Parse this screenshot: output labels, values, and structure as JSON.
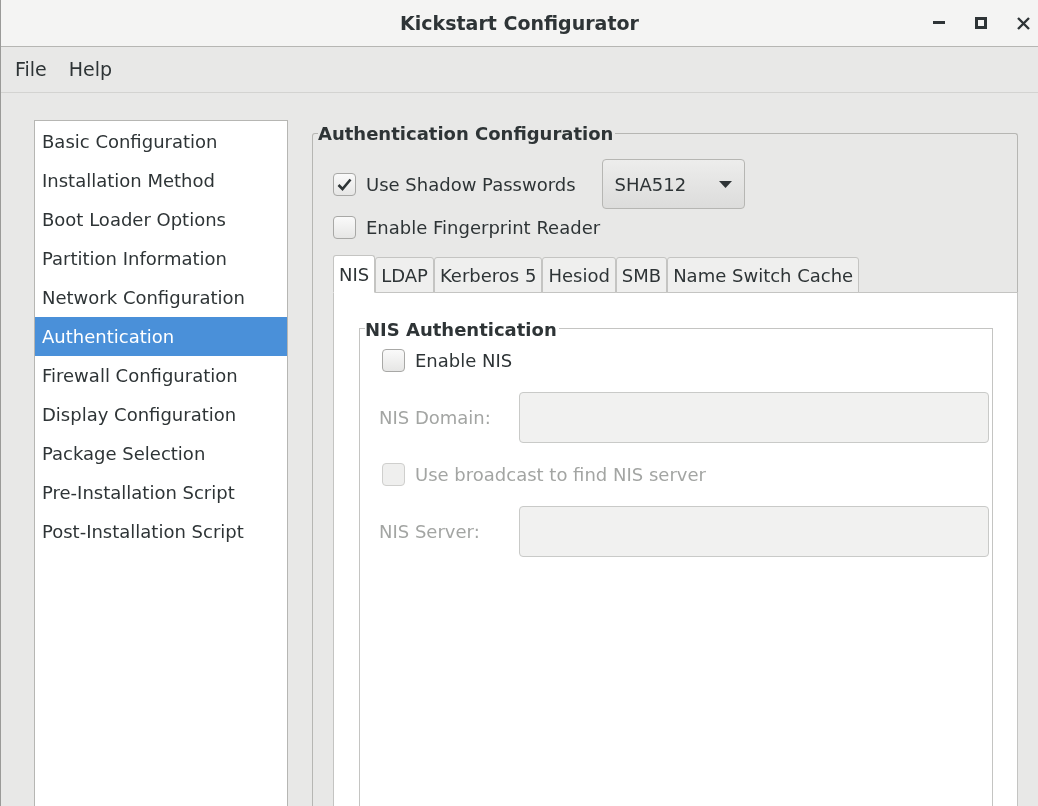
{
  "window": {
    "title": "Kickstart Configurator"
  },
  "menu": [
    "File",
    "Help"
  ],
  "sidebar": {
    "items": [
      {
        "label": "Basic Configuration",
        "selected": false
      },
      {
        "label": "Installation Method",
        "selected": false
      },
      {
        "label": "Boot Loader Options",
        "selected": false
      },
      {
        "label": "Partition Information",
        "selected": false
      },
      {
        "label": "Network Configuration",
        "selected": false
      },
      {
        "label": "Authentication",
        "selected": true
      },
      {
        "label": "Firewall Configuration",
        "selected": false
      },
      {
        "label": "Display Configuration",
        "selected": false
      },
      {
        "label": "Package Selection",
        "selected": false
      },
      {
        "label": "Pre-Installation Script",
        "selected": false
      },
      {
        "label": "Post-Installation Script",
        "selected": false
      }
    ]
  },
  "auth": {
    "title": "Authentication Configuration",
    "shadow": {
      "label": "Use Shadow Passwords",
      "checked": true,
      "algorithm": "SHA512"
    },
    "fingerprint": {
      "label": "Enable Fingerprint Reader",
      "checked": false
    },
    "tabs": [
      {
        "label": "NIS",
        "selected": true
      },
      {
        "label": "LDAP",
        "selected": false
      },
      {
        "label": "Kerberos 5",
        "selected": false
      },
      {
        "label": "Hesiod",
        "selected": false
      },
      {
        "label": "SMB",
        "selected": false
      },
      {
        "label": "Name Switch Cache",
        "selected": false
      }
    ],
    "nis": {
      "title": "NIS Authentication",
      "rows": [
        {
          "kind": "checkbox",
          "label": "Enable NIS",
          "checked": false,
          "disabled": false
        },
        {
          "kind": "field",
          "label": "NIS Domain:",
          "disabled": true
        },
        {
          "kind": "checkbox",
          "label": "Use broadcast to find NIS server",
          "checked": false,
          "disabled": true
        },
        {
          "kind": "field",
          "label": "NIS Server:",
          "disabled": true
        }
      ]
    }
  }
}
